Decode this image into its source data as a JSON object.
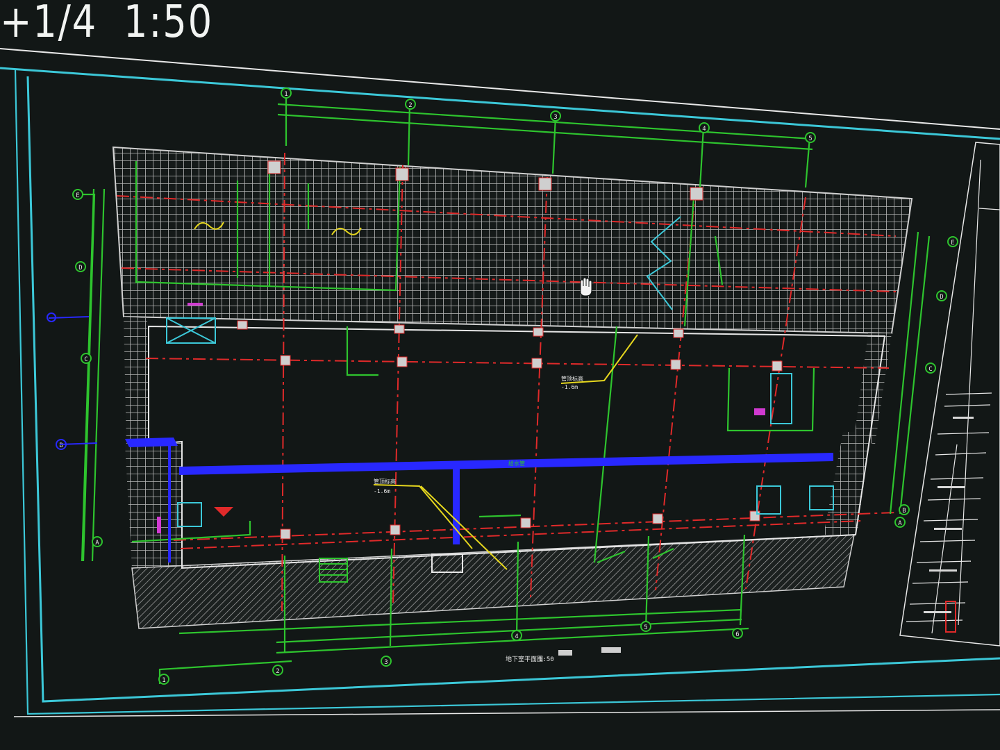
{
  "header": {
    "scale_text": "+1/4  1:50"
  },
  "grid_bubbles_top": [
    "1",
    "2",
    "3",
    "4",
    "5"
  ],
  "grid_bubbles_bottom": [
    "1",
    "2",
    "3",
    "4",
    "5",
    "6"
  ],
  "grid_bubbles_left": [
    "E",
    "D",
    "C",
    "B",
    "A"
  ],
  "grid_bubbles_right": [
    "E",
    "D",
    "C",
    "B",
    "A"
  ],
  "annotations": {
    "center_note": "管顶标高",
    "center_elev": "-1.6m",
    "left_note": "管顶标高",
    "left_elev": "-1.6m",
    "blue_line_label": "给水管",
    "drawing_title": "地下室平面图",
    "drawing_scale": "1:50"
  },
  "colors": {
    "background": "#121716",
    "frame_cyan": "#3cc8d8",
    "frame_green": "#2ec42e",
    "hatch_gray": "#b9b9b9",
    "axis_red": "#e02a2a",
    "pipe_blue": "#2828ff",
    "leader_yellow": "#e5d61e",
    "magenta": "#d13ad1"
  },
  "cursor": {
    "icon": "hand-cursor-icon"
  }
}
